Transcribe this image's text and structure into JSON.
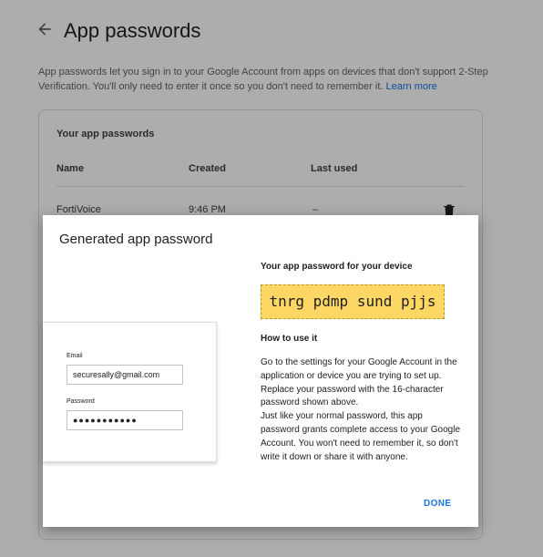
{
  "page": {
    "title": "App passwords",
    "description": "App passwords let you sign in to your Google Account from apps on devices that don't support 2-Step Verification. You'll only need to enter it once so you don't need to remember it.",
    "learn_more": "Learn more"
  },
  "card": {
    "title": "Your app passwords",
    "columns": [
      "Name",
      "Created",
      "Last used"
    ],
    "rows": [
      {
        "name": "FortiVoice",
        "created": "9:46 PM",
        "last_used": "–"
      }
    ]
  },
  "dialog": {
    "title": "Generated app password",
    "illustration": {
      "email_label": "Email",
      "email_value": "securesally@gmail.com",
      "password_label": "Password",
      "password_value": "●●●●●●●●●●●"
    },
    "password_heading": "Your app password for your device",
    "password": "tnrg pdmp sund pjjs",
    "how_heading": "How to use it",
    "how_paragraph1": "Go to the settings for your Google Account in the application or device you are trying to set up. Replace your password with the 16-character password shown above.",
    "how_paragraph2": "Just like your normal password, this app password grants complete access to your Google Account. You won't need to remember it, so don't write it down or share it with anyone.",
    "done": "DONE"
  },
  "icons": {
    "back": "arrow-back-icon",
    "delete": "trash-icon"
  },
  "colors": {
    "accent": "#1a73e8",
    "password_highlight": "#fdd663"
  }
}
